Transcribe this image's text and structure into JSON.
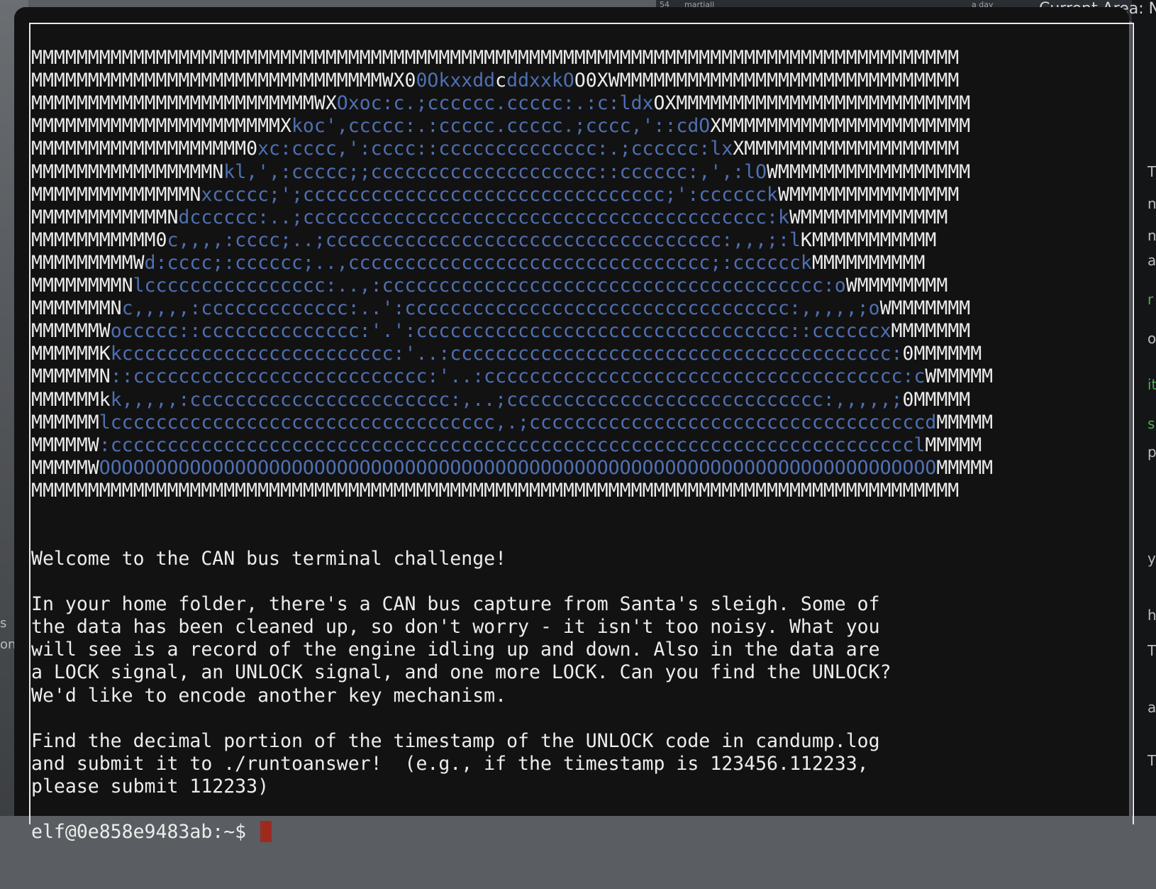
{
  "background": {
    "top_right_number": "54",
    "top_right_name": "martiall",
    "top_right_time": "a day",
    "top_right_heading": "Current Area: N",
    "left_fragments": [
      "s",
      "on"
    ],
    "right_fragments": [
      "T",
      "n",
      "n",
      "a",
      "r",
      "o",
      "it",
      "s",
      "p",
      "y",
      "h",
      "T",
      "ar",
      "T"
    ]
  },
  "terminal": {
    "ascii_art": [
      [
        [
          "w",
          "MMMMMMMMMMMMMMMMMMMMMMMMMMMMMMMMMMMMMMMMMMMMMMMMMMMMMMMMMMMMMMMMMMMMMMMMMMMMMMMMMM"
        ]
      ],
      [
        [
          "w",
          "MMMMMMMMMMMMMMMMMMMMMMMMMMMMMMMWX0"
        ],
        [
          "b",
          "0Okxxdd"
        ],
        [
          "w",
          "c"
        ],
        [
          "b",
          "ddxxkO"
        ],
        [
          "w",
          "O0XWMMMMMMMMMMMMMMMMMMMMMMMMMMMMMM"
        ]
      ],
      [
        [
          "w",
          "MMMMMMMMMMMMMMMMMMMMMMMMMWX"
        ],
        [
          "b",
          "Oxoc:c.;cccccc.ccccc:.:c:ldx"
        ],
        [
          "w",
          "OXMMMMMMMMMMMMMMMMMMMMMMMMMM"
        ]
      ],
      [
        [
          "w",
          "MMMMMMMMMMMMMMMMMMMMMMX"
        ],
        [
          "b",
          "koc',ccccc:.:ccccc.ccccc.;cccc,'::cdO"
        ],
        [
          "w",
          "XMMMMMMMMMMMMMMMMMMMMMM"
        ]
      ],
      [
        [
          "w",
          "MMMMMMMMMMMMMMMMMMM0"
        ],
        [
          "b",
          "xc:cccc,':cccc::cccccccccccccc:.;cccccc:lx"
        ],
        [
          "w",
          "XMMMMMMMMMMMMMMMMMMM"
        ]
      ],
      [
        [
          "w",
          "MMMMMMMMMMMMMMMMN"
        ],
        [
          "b",
          "kl,',:ccccc;;cccccccccccccccccccc::cccccc:,',:lO"
        ],
        [
          "w",
          "WMMMMMMMMMMMMMMMMM"
        ]
      ],
      [
        [
          "w",
          "MMMMMMMMMMMMMMN"
        ],
        [
          "b",
          "xccccc;';cccccccccccccccccccccccccccccccc;':cccccck"
        ],
        [
          "w",
          "WMMMMMMMMMMMMMMM"
        ]
      ],
      [
        [
          "w",
          "MMMMMMMMMMMMN"
        ],
        [
          "b",
          "dcccccc:..;ccccccccccccccccccccccccccccccccccccccccc:k"
        ],
        [
          "w",
          "WMMMMMMMMMMMMM"
        ]
      ],
      [
        [
          "w",
          "MMMMMMMMMMM0"
        ],
        [
          "b",
          "c,,,,:cccc;..;ccccccccccccccccccccccccccccccccccc:,,,;:l"
        ],
        [
          "w",
          "KMMMMMMMMMMM"
        ]
      ],
      [
        [
          "w",
          "MMMMMMMMMW"
        ],
        [
          "b",
          "d:cccc;:cccccc;..,cccccccccccccccccccccccccccccccc;:cccccck"
        ],
        [
          "w",
          "MMMMMMMMMM"
        ]
      ],
      [
        [
          "w",
          "MMMMMMMMN"
        ],
        [
          "b",
          "lcccccccccccccccc:..,:ccccccccccccccccccccccccccccccccccccccc:o"
        ],
        [
          "w",
          "WMMMMMMMM"
        ]
      ],
      [
        [
          "w",
          "MMMMMMMN"
        ],
        [
          "b",
          "c,,,,,:ccccccccccccc:..':cccccccccccccccccccccccccccccccccc:,,,,,;o"
        ],
        [
          "w",
          "WMMMMMMM"
        ]
      ],
      [
        [
          "w",
          "MMMMMMW"
        ],
        [
          "b",
          "occccc::cccccccccccccc:'.':ccccccccccccccccccccccccccccccccc::ccccccx"
        ],
        [
          "w",
          "MMMMMMM"
        ]
      ],
      [
        [
          "w",
          "MMMMMMK"
        ],
        [
          "b",
          "kcccccccccccccccccccccccc:'..:ccccccccccccccccccccccccccccccccccccccc:"
        ],
        [
          "w",
          "0MMMMMM"
        ]
      ],
      [
        [
          "w",
          "MMMMMMN"
        ],
        [
          "b",
          "::cccccccccccccccccccccccccc:'..:ccccccccccccccccccccccccccccccccccccc:c"
        ],
        [
          "w",
          "WMMMMM"
        ]
      ],
      [
        [
          "w",
          "MMMMMMk"
        ],
        [
          "b",
          "k,,,,,:ccccccccccccccccccccccc:,..;cccccccccccccccccccccccccccc:,,,,,;"
        ],
        [
          "w",
          "0MMMMM"
        ]
      ],
      [
        [
          "w",
          "MMMMMM"
        ],
        [
          "b",
          "lcccccccccccccccccccccccccccccccccc,.;cccccccccccccccccccccccccccccccccccd"
        ],
        [
          "w",
          "MMMMM"
        ]
      ],
      [
        [
          "w",
          "MMMMMW"
        ],
        [
          "b",
          ":cccccccccccccccccccccccccccccccccccccccccccccccccccccccccccccccccccccccl"
        ],
        [
          "w",
          "MMMMM"
        ]
      ],
      [
        [
          "w",
          "MMMMMW"
        ],
        [
          "b",
          "OOOOOOOOOOOOOOOOOOOOOOOOOOOOOOOOOOOOOOOOOOOOOOOOOOOOOOOOOOOOOOOOOOOOOOOOOO"
        ],
        [
          "w",
          "MMMMM"
        ]
      ],
      [
        [
          "w",
          "MMMMMMMMMMMMMMMMMMMMMMMMMMMMMMMMMMMMMMMMMMMMMMMMMMMMMMMMMMMMMMMMMMMMMMMMMMMMMMMMMM"
        ]
      ]
    ],
    "welcome": "Welcome to the CAN bus terminal challenge!",
    "intro": "In your home folder, there's a CAN bus capture from Santa's sleigh. Some of\nthe data has been cleaned up, so don't worry - it isn't too noisy. What you\nwill see is a record of the engine idling up and down. Also in the data are\na LOCK signal, an UNLOCK signal, and one more LOCK. Can you find the UNLOCK?\nWe'd like to encode another key mechanism.",
    "task": "Find the decimal portion of the timestamp of the UNLOCK code in candump.log\nand submit it to ./runtoanswer!  (e.g., if the timestamp is 123456.112233,\nplease submit 112233)",
    "prompt": "elf@0e858e9483ab:~$ "
  },
  "colors": {
    "terminal_bg": "#121212",
    "text": "#ececec",
    "art_blue": "#4e70b3",
    "cursor": "#9e2a1f"
  }
}
